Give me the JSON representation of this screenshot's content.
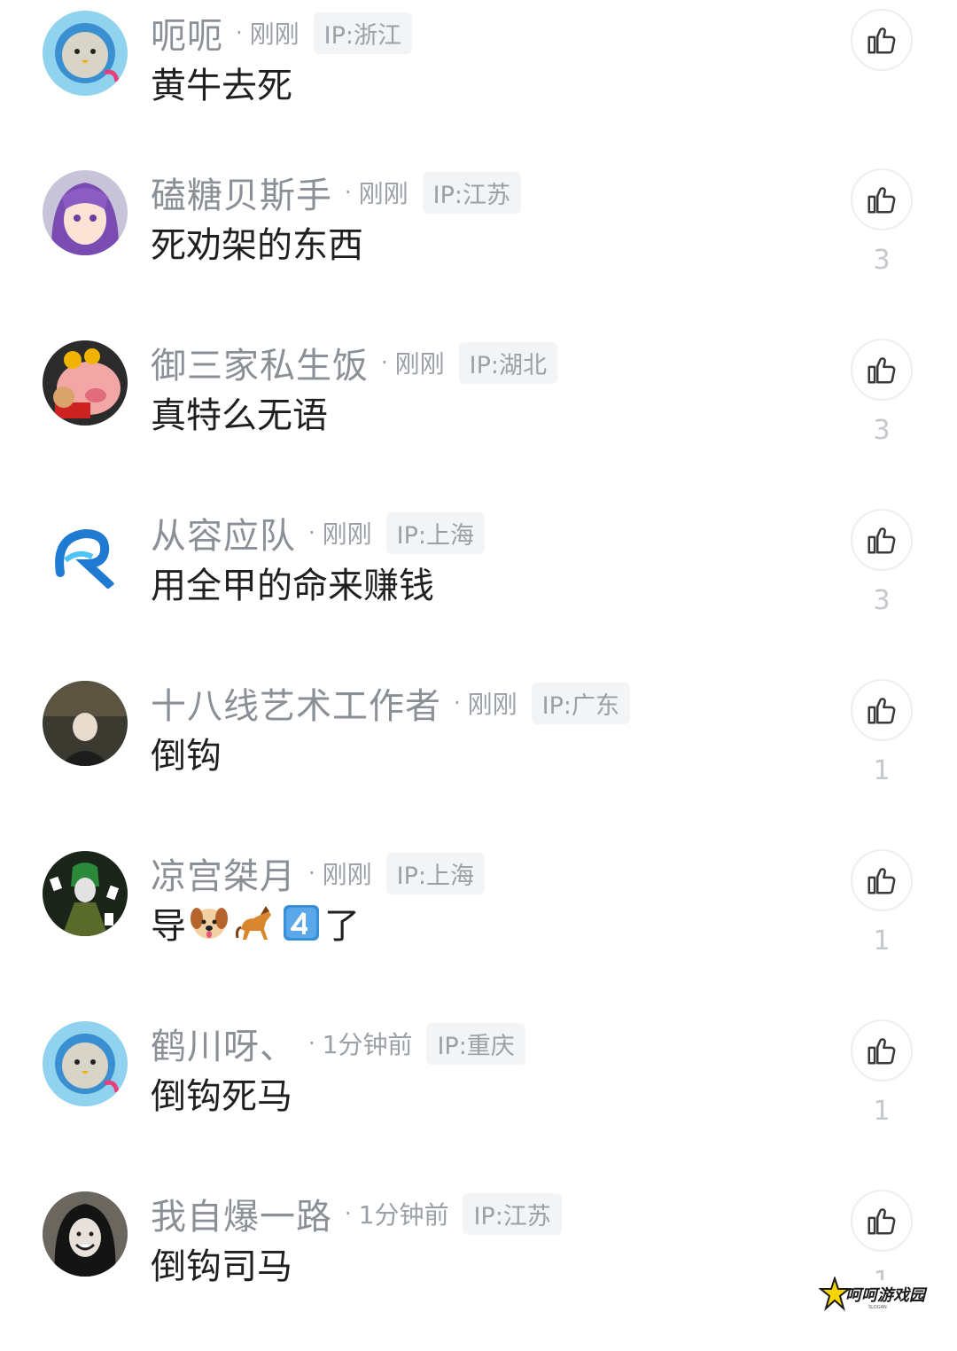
{
  "colors": {
    "username": "#8b8f96",
    "content": "#1f1f1f",
    "muted": "#9aa0a6",
    "badge_bg": "#f3f4f6"
  },
  "comments": [
    {
      "username": "呃呃",
      "time": "刚刚",
      "ip": "IP:浙江",
      "content": "黄牛去死",
      "like_count": "",
      "avatar": "seal-avatar"
    },
    {
      "username": "磕糖贝斯手",
      "time": "刚刚",
      "ip": "IP:江苏",
      "content": "死劝架的东西",
      "like_count": "3",
      "avatar": "anime-girl-avatar"
    },
    {
      "username": "御三家私生饭",
      "time": "刚刚",
      "ip": "IP:湖北",
      "content": "真特么无语",
      "like_count": "3",
      "avatar": "cartoon-pig-avatar"
    },
    {
      "username": "从容应队",
      "time": "刚刚",
      "ip": "IP:上海",
      "content": "用全甲的命来赚钱",
      "like_count": "3",
      "avatar": "r-wave-logo-avatar"
    },
    {
      "username": "十八线艺术工作者",
      "time": "刚刚",
      "ip": "IP:广东",
      "content": "倒钩",
      "like_count": "1",
      "avatar": "photo-avatar"
    },
    {
      "username": "凉宫桀月",
      "time": "刚刚",
      "ip": "IP:上海",
      "content_prefix": "导",
      "content_suffix": "了",
      "emojis": [
        "dog-face-emoji",
        "horse-emoji",
        "keycap-4-emoji"
      ],
      "like_count": "1",
      "avatar": "card-character-avatar"
    },
    {
      "username": "鹤川呀、",
      "time": "1分钟前",
      "ip": "IP:重庆",
      "content": "倒钩死马",
      "like_count": "1",
      "avatar": "seal-avatar"
    },
    {
      "username": "我自爆一路",
      "time": "1分钟前",
      "ip": "IP:江苏",
      "content": "倒钩司马",
      "like_count": "1",
      "avatar": "dark-hair-avatar"
    }
  ],
  "watermark": {
    "text": "呵呵游戏园",
    "sub": "SLOGAN"
  },
  "icons": {
    "like": "thumbs-up-icon"
  }
}
